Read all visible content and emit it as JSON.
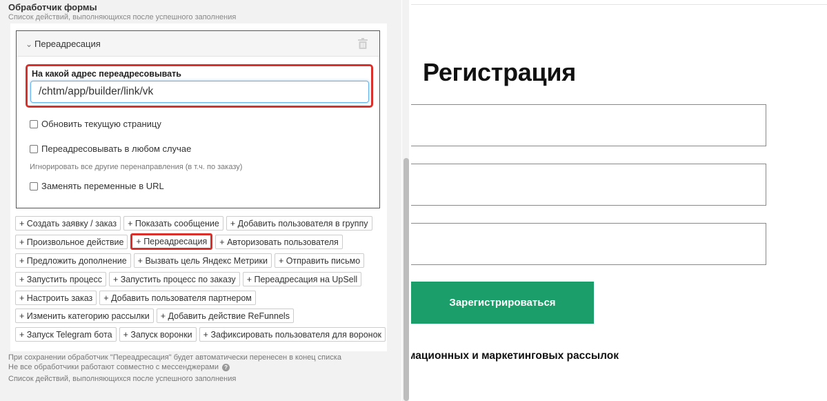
{
  "form_handler": {
    "title": "Обработчик формы",
    "subtitle": "Список действий, выполняющихся после успешного заполнения",
    "redirect_card": {
      "title": "Переадресация",
      "url_label": "На какой адрес переадресовывать",
      "url_value": "/chtm/app/builder/link/vk",
      "checkboxes": [
        {
          "label": "Обновить текущую страницу",
          "checked": false
        },
        {
          "label": "Переадресовывать в любом случае",
          "checked": false
        },
        {
          "label": "Заменять переменные в URL",
          "checked": false
        }
      ],
      "hint": "Игнорировать все другие перенаправления (в т.ч. по заказу)"
    },
    "actions": [
      [
        "+ Создать заявку / заказ",
        "+ Показать сообщение",
        "+ Добавить пользователя в группу"
      ],
      [
        "+ Произвольное действие",
        "+ Переадресация",
        "+ Авторизовать пользователя"
      ],
      [
        "+ Предложить дополнение",
        "+ Вызвать цель Яндекс Метрики",
        "+ Отправить письмо"
      ],
      [
        "+ Запустить процесс",
        "+ Запустить процесс по заказу",
        "+ Переадресация на UpSell"
      ],
      [
        "+ Настроить заказ",
        "+ Добавить пользователя партнером"
      ],
      [
        "+ Изменить категорию рассылки",
        "+ Добавить действие ReFunnels"
      ],
      [
        "+ Запуск Telegram бота",
        "+ Запуск воронки",
        "+ Зафиксировать пользователя для воронок"
      ]
    ],
    "highlighted_action": "+ Переадресация",
    "notes": [
      "При сохранении обработчик \"Переадресация\" будет автоматически перенесен в конец списка",
      "Не все обработчики работают совместно с мессенджерами",
      "Список действий, выполняющихся после успешного заполнения"
    ]
  },
  "preview": {
    "title": "Регистрация",
    "button_label": "Зарегистрироваться",
    "consent_text": "мационных и маркетинговых рассылок"
  },
  "colors": {
    "highlight": "#d9302b",
    "primary_button": "#1b9e69",
    "input_focus": "#66afe9"
  }
}
